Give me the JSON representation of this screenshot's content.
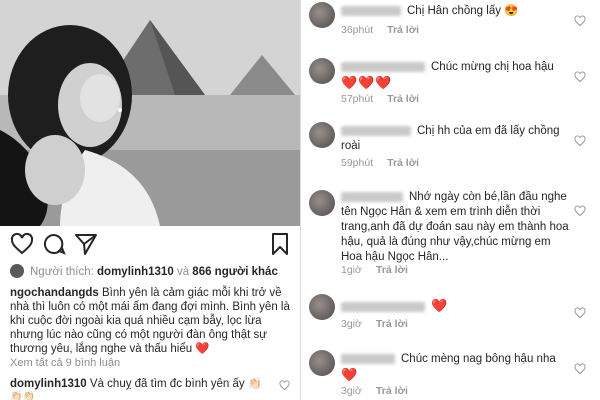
{
  "post": {
    "liked_by_label": "Người thích:",
    "liked_by_user": "domylinh1310",
    "and_label": "và",
    "others_label": "866 người khác",
    "caption_user": "ngochandangds",
    "caption_text": "Bình yên là cảm giác mỗi khi trở về nhà thì luôn có một mái ấm đang đợi mình.  Bình yên là khi cuộc đời ngoài kia quá nhiều cạm bẫy, lọc lừa nhưng lúc nào cũng có một người đàn ông thật sự thương yêu, lắng nghe và thấu hiểu",
    "caption_emoji": "❤️",
    "view_all_comments": "Xem tất cả 9 bình luận",
    "reply_user": "domylinh1310",
    "reply_text": "Và chuỵ đã tìm đc bình yên ấy",
    "reply_emoji": "👏🏻",
    "claps_row": "👏🏻👏🏻"
  },
  "comments": [
    {
      "text": "Chị Hân chồng lấy",
      "emoji": "😍",
      "time": "36phút",
      "reply": "Trả lời"
    },
    {
      "text": "Chúc mừng chị hoa hậu",
      "hearts": "❤️❤️❤️",
      "time": "57phút",
      "reply": "Trả lời"
    },
    {
      "text": "Chị hh của em đã lấy chồng roài",
      "time": "59phút",
      "reply": "Trả lời"
    },
    {
      "text": "Nhớ ngày còn bé,lần đầu nghe tên Ngọc Hân & xem em trình diễn thời trang,anh đã dự đoán sau này em thành hoa hậu, quả là đúng như vậy,chúc mừng em Hoa hậu Ngọc Hân...",
      "time": "1giờ",
      "reply": "Trả lời"
    },
    {
      "text": "",
      "hearts": "❤️",
      "time": "3giờ",
      "reply": "Trả lời"
    },
    {
      "text": "Chúc mèng nag bông hậu nha",
      "hearts": "❤️",
      "time": "3giờ",
      "reply": "Trả lời"
    }
  ],
  "icons": {
    "like": "heart-outline-icon",
    "comment": "speech-bubble-icon",
    "share": "paper-plane-icon",
    "save": "bookmark-icon"
  },
  "colors": {
    "heart_red": "#e0245e",
    "muted_text": "#8e8e8e"
  }
}
